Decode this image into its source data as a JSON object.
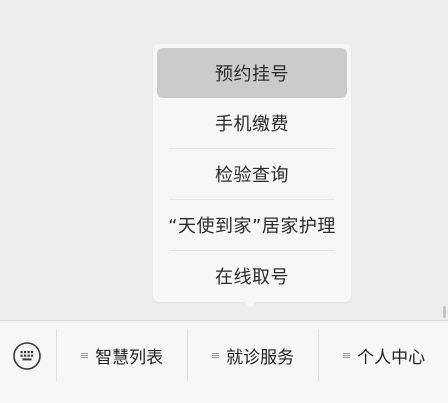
{
  "popup_menu": {
    "items": [
      {
        "label": "预约挂号",
        "active": true
      },
      {
        "label": "手机缴费",
        "active": false
      },
      {
        "label": "检验查询",
        "active": false
      },
      {
        "label": "“天使到家”居家护理",
        "active": false
      },
      {
        "label": "在线取号",
        "active": false
      }
    ]
  },
  "bottom_bar": {
    "keyboard_icon": "keyboard-icon",
    "tabs": [
      {
        "label": "智慧列表",
        "icon": "menu-icon"
      },
      {
        "label": "就诊服务",
        "icon": "menu-icon"
      },
      {
        "label": "个人中心",
        "icon": "menu-icon"
      }
    ]
  },
  "colors": {
    "background": "#ededed",
    "popup": "#f7f7f7",
    "active_item": "#cbcbcb",
    "text": "#222222"
  }
}
